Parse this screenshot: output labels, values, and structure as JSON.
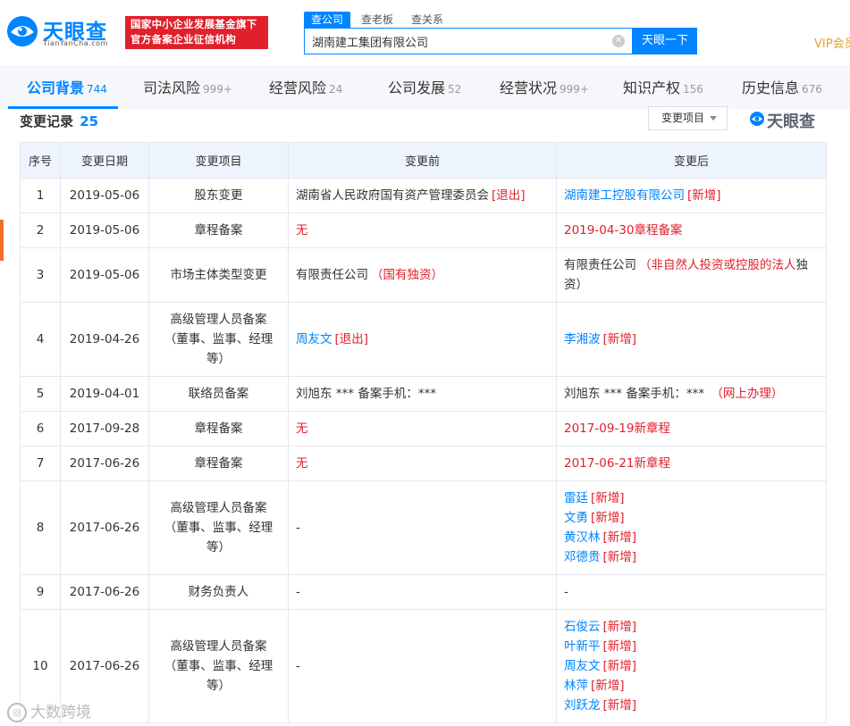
{
  "header": {
    "logo_text": "天眼查",
    "logo_sub": "TianYanCha.com",
    "gov_badge": [
      "国家中小企业发展基金旗下",
      "官方备案企业征信机构"
    ],
    "search_tabs": [
      "查公司",
      "查老板",
      "查关系"
    ],
    "search_value": "湖南建工集团有限公司",
    "search_button": "天眼一下",
    "vip": "VIP会员"
  },
  "nav": [
    {
      "label": "公司背景",
      "count": "744",
      "active": true
    },
    {
      "label": "司法风险",
      "count": "999+"
    },
    {
      "label": "经营风险",
      "count": "24"
    },
    {
      "label": "公司发展",
      "count": "52"
    },
    {
      "label": "经营状况",
      "count": "999+"
    },
    {
      "label": "知识产权",
      "count": "156"
    },
    {
      "label": "历史信息",
      "count": "676"
    }
  ],
  "section": {
    "title": "变更记录",
    "count": "25",
    "filter_label": "变更项目",
    "watermark_logo": "天眼查"
  },
  "table": {
    "headers": [
      "序号",
      "变更日期",
      "变更项目",
      "变更前",
      "变更后"
    ],
    "rows": [
      {
        "no": "1",
        "date": "2019-05-06",
        "item": [
          "股东变更"
        ],
        "before": [
          {
            "text": "湖南省人民政府国有资产管理委员会",
            "color": "normal",
            "tag": "[退出]"
          }
        ],
        "after": [
          {
            "text": "湖南建工控股有限公司",
            "color": "blue",
            "tag": "[新增]"
          }
        ]
      },
      {
        "no": "2",
        "date": "2019-05-06",
        "item": [
          "章程备案"
        ],
        "before": [
          {
            "text": "无",
            "color": "red"
          }
        ],
        "after": [
          {
            "text": "2019-04-30章程备案",
            "color": "red"
          }
        ]
      },
      {
        "no": "3",
        "date": "2019-05-06",
        "item": [
          "市场主体类型变更"
        ],
        "before": [
          {
            "text": "有限责任公司",
            "color": "normal",
            "tag": "（国有独资）"
          }
        ],
        "after": [
          {
            "text": "有限责任公司",
            "color": "normal",
            "tag": "（非自然人投资或控股的法人",
            "suffix": "独资）"
          }
        ]
      },
      {
        "no": "4",
        "date": "2019-04-26",
        "item": [
          "高级管理人员备案",
          "（董事、监事、经理",
          "等）"
        ],
        "before": [
          {
            "text": "周友文",
            "color": "blue",
            "tag": "[退出]"
          }
        ],
        "after": [
          {
            "text": "李湘波",
            "color": "blue",
            "tag": "[新增]"
          }
        ]
      },
      {
        "no": "5",
        "date": "2019-04-01",
        "item": [
          "联络员备案"
        ],
        "before": [
          {
            "text": "刘旭东 *** 备案手机：***",
            "color": "normal"
          }
        ],
        "after": [
          {
            "text": "刘旭东 *** 备案手机：***",
            "color": "normal",
            "tag": " （网上办理）"
          }
        ]
      },
      {
        "no": "6",
        "date": "2017-09-28",
        "item": [
          "章程备案"
        ],
        "before": [
          {
            "text": "无",
            "color": "red"
          }
        ],
        "after": [
          {
            "text": "2017-09-19新章程",
            "color": "red"
          }
        ]
      },
      {
        "no": "7",
        "date": "2017-06-26",
        "item": [
          "章程备案"
        ],
        "before": [
          {
            "text": "无",
            "color": "red"
          }
        ],
        "after": [
          {
            "text": "2017-06-21新章程",
            "color": "red"
          }
        ]
      },
      {
        "no": "8",
        "date": "2017-06-26",
        "item": [
          "高级管理人员备案",
          "（董事、监事、经理",
          "等）"
        ],
        "before": [
          {
            "text": "-",
            "color": "normal"
          }
        ],
        "after": [
          {
            "text": "雷廷",
            "color": "blue",
            "tag": "[新增]"
          },
          {
            "text": "文勇",
            "color": "blue",
            "tag": "[新增]"
          },
          {
            "text": "黄汉林",
            "color": "blue",
            "tag": "[新增]"
          },
          {
            "text": "邓德贵",
            "color": "blue",
            "tag": "[新增]"
          }
        ]
      },
      {
        "no": "9",
        "date": "2017-06-26",
        "item": [
          "财务负责人"
        ],
        "before": [
          {
            "text": "-",
            "color": "normal"
          }
        ],
        "after": [
          {
            "text": "-",
            "color": "normal"
          }
        ]
      },
      {
        "no": "10",
        "date": "2017-06-26",
        "item": [
          "高级管理人员备案",
          "（董事、监事、经理",
          "等）"
        ],
        "before": [
          {
            "text": "-",
            "color": "normal"
          }
        ],
        "after": [
          {
            "text": "石俊云",
            "color": "blue",
            "tag": "[新增]"
          },
          {
            "text": "叶新平",
            "color": "blue",
            "tag": "[新增]"
          },
          {
            "text": "周友文",
            "color": "blue",
            "tag": "[新增]"
          },
          {
            "text": "林萍",
            "color": "blue",
            "tag": "[新增]"
          },
          {
            "text": "刘跃龙",
            "color": "blue",
            "tag": "[新增]"
          }
        ]
      }
    ]
  },
  "bottom_watermark": "大数跨境",
  "colors": {
    "brand": "#0084ff",
    "red": "#e0202b",
    "vip": "#e8a31b",
    "accent": "#f36e2b"
  }
}
